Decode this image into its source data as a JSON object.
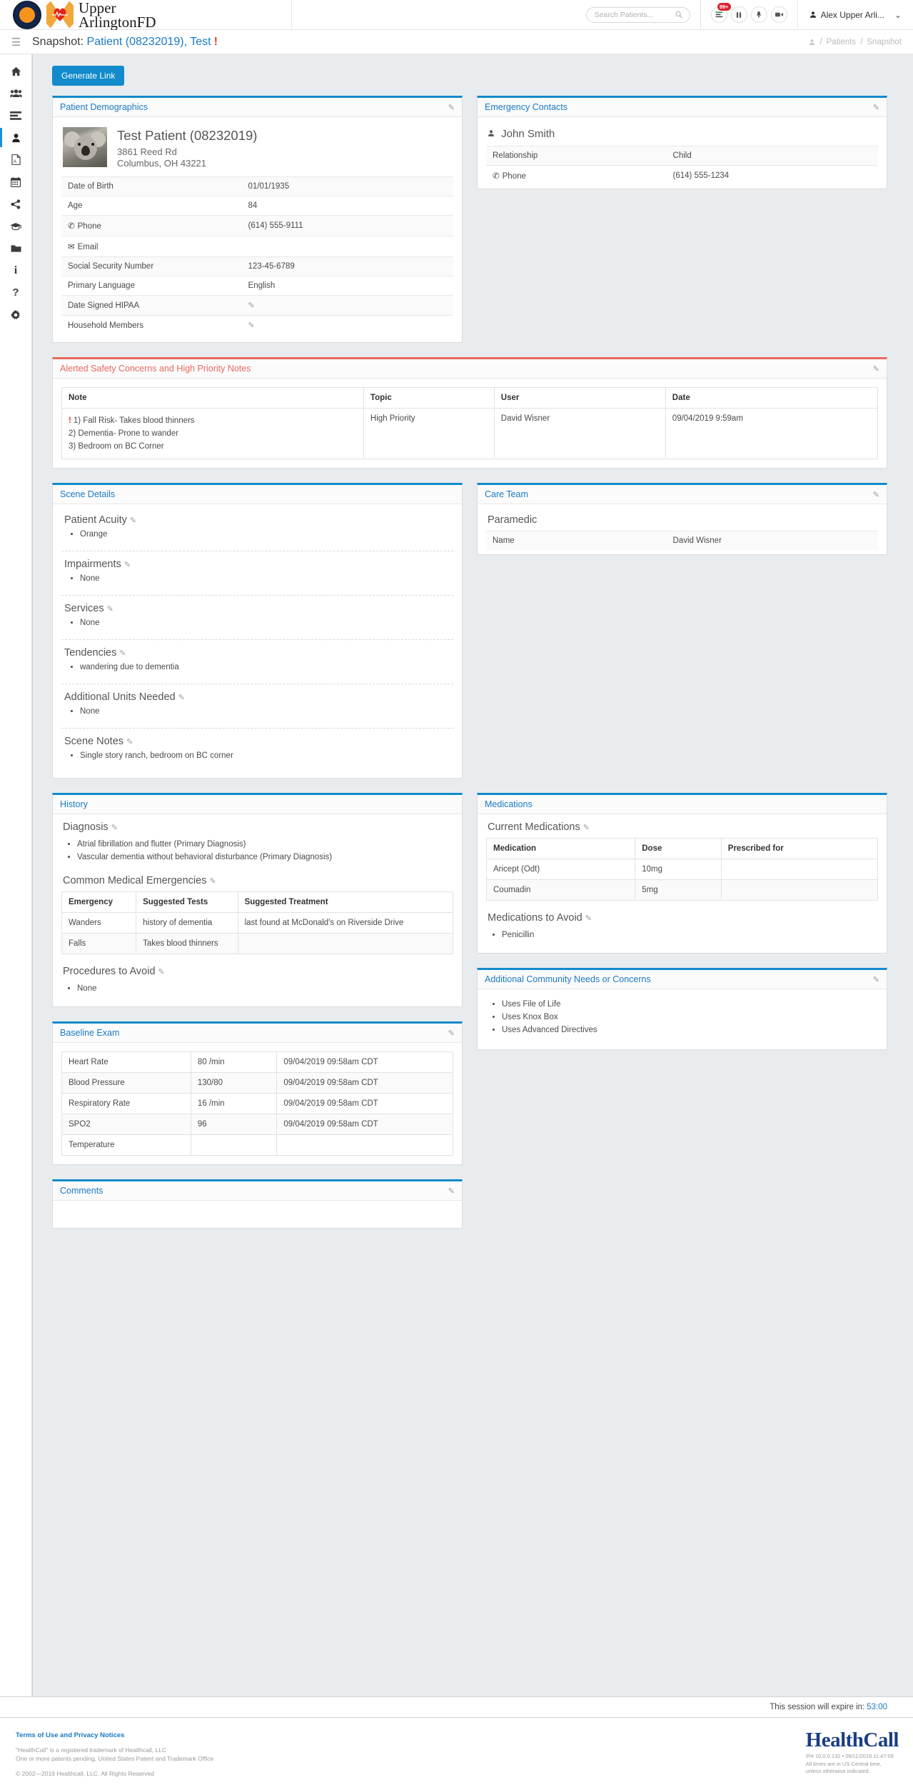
{
  "header": {
    "brand_line1": "Upper",
    "brand_line2": "ArlingtonFD",
    "search_placeholder": "Search Patients...",
    "notification_badge": "99+",
    "user_name": "Alex Upper Arli...",
    "icons": [
      "list-badge-icon",
      "pause-icon",
      "bell-icon",
      "video-icon"
    ]
  },
  "titlebar": {
    "prefix": "Snapshot:",
    "patient_link": "Patient (08232019), Test",
    "alert_mark": "!",
    "breadcrumb": [
      "Patients",
      "Snapshot"
    ]
  },
  "sidebar": {
    "items": [
      {
        "name": "home",
        "glyph": "⌂"
      },
      {
        "name": "users",
        "glyph": "👥"
      },
      {
        "name": "list",
        "glyph": "☰"
      },
      {
        "name": "patient",
        "glyph": "👤"
      },
      {
        "name": "pdf",
        "glyph": "🗎"
      },
      {
        "name": "calendar",
        "glyph": "📅"
      },
      {
        "name": "share",
        "glyph": "⛓"
      },
      {
        "name": "education",
        "glyph": "🎓"
      },
      {
        "name": "folder",
        "glyph": "📁"
      },
      {
        "name": "info",
        "glyph": "ℹ"
      },
      {
        "name": "help",
        "glyph": "?"
      },
      {
        "name": "settings",
        "glyph": "⚙"
      }
    ]
  },
  "actions": {
    "generate_link": "Generate Link"
  },
  "demographics": {
    "title": "Patient Demographics",
    "patient_name": "Test Patient (08232019)",
    "address_line1": "3861 Reed Rd",
    "address_line2": "Columbus, OH 43221",
    "rows": [
      {
        "label": "Date of Birth",
        "value": "01/01/1935",
        "icon": ""
      },
      {
        "label": "Age",
        "value": "84",
        "icon": ""
      },
      {
        "label": "Phone",
        "value": "(614) 555-9111",
        "icon": "phone-icon"
      },
      {
        "label": "Email",
        "value": "",
        "icon": "envelope-icon"
      },
      {
        "label": "Social Security Number",
        "value": "123-45-6789",
        "icon": ""
      },
      {
        "label": "Primary Language",
        "value": "English",
        "icon": ""
      },
      {
        "label": "Date Signed HIPAA",
        "value": "",
        "icon": "",
        "edit": true
      },
      {
        "label": "Household Members",
        "value": "",
        "icon": "",
        "edit": true
      }
    ]
  },
  "emergency_contacts": {
    "title": "Emergency Contacts",
    "contact_name": "John Smith",
    "rows": [
      {
        "label": "Relationship",
        "value": "Child",
        "icon": ""
      },
      {
        "label": "Phone",
        "value": "(614) 555-1234",
        "icon": "phone-icon"
      }
    ]
  },
  "safety": {
    "title": "Alerted Safety Concerns and High Priority Notes",
    "columns": [
      "Note",
      "Topic",
      "User",
      "Date"
    ],
    "rows": [
      {
        "note_lines": [
          "1) Fall Risk- Takes blood thinners",
          "2) Dementia- Prone to wander",
          "3) Bedroom on BC Corner"
        ],
        "topic": "High Priority",
        "user": "David Wisner",
        "date": "09/04/2019 9:59am"
      }
    ]
  },
  "scene_details": {
    "title": "Scene Details",
    "sections": [
      {
        "heading": "Patient Acuity",
        "items": [
          "Orange"
        ]
      },
      {
        "heading": "Impairments",
        "items": [
          "None"
        ]
      },
      {
        "heading": "Services",
        "items": [
          "None"
        ]
      },
      {
        "heading": "Tendencies",
        "items": [
          "wandering due to dementia"
        ]
      },
      {
        "heading": "Additional Units Needed",
        "items": [
          "None"
        ]
      },
      {
        "heading": "Scene Notes",
        "items": [
          "Single story ranch, bedroom on BC corner"
        ]
      }
    ]
  },
  "care_team": {
    "title": "Care Team",
    "role": "Paramedic",
    "rows": [
      {
        "label": "Name",
        "value": "David Wisner"
      }
    ]
  },
  "history": {
    "title": "History",
    "diagnosis_heading": "Diagnosis",
    "diagnosis": [
      "Atrial fibrillation and flutter (Primary Diagnosis)",
      "Vascular dementia without behavioral disturbance (Primary Diagnosis)"
    ],
    "emergencies_heading": "Common Medical Emergencies",
    "emergencies_columns": [
      "Emergency",
      "Suggested Tests",
      "Suggested Treatment"
    ],
    "emergencies_rows": [
      [
        "Wanders",
        "history of dementia",
        "last found at McDonald's on Riverside Drive"
      ],
      [
        "Falls",
        "Takes blood thinners",
        ""
      ]
    ],
    "procedures_heading": "Procedures to Avoid",
    "procedures": [
      "None"
    ]
  },
  "medications": {
    "title": "Medications",
    "current_heading": "Current Medications",
    "columns": [
      "Medication",
      "Dose",
      "Prescribed for"
    ],
    "rows": [
      [
        "Aricept (Odt)",
        "10mg",
        ""
      ],
      [
        "Coumadin",
        "5mg",
        ""
      ]
    ],
    "avoid_heading": "Medications to Avoid",
    "avoid": [
      "Penicillin"
    ]
  },
  "community": {
    "title": "Additional Community Needs or Concerns",
    "items": [
      "Uses File of Life",
      "Uses Knox Box",
      "Uses Advanced Directives"
    ]
  },
  "baseline": {
    "title": "Baseline Exam",
    "rows": [
      [
        "Heart Rate",
        "80 /min",
        "09/04/2019 09:58am CDT"
      ],
      [
        "Blood Pressure",
        "130/80",
        "09/04/2019 09:58am CDT"
      ],
      [
        "Respiratory Rate",
        "16 /min",
        "09/04/2019 09:58am CDT"
      ],
      [
        "SPO2",
        "96",
        "09/04/2019 09:58am CDT"
      ],
      [
        "Temperature",
        "",
        ""
      ]
    ]
  },
  "comments": {
    "title": "Comments"
  },
  "session": {
    "label": "This session will expire in:",
    "time": "53:00"
  },
  "footer": {
    "terms": "Terms of Use and Privacy Notices",
    "line1": "\"HealthCall\" is a registered trademark of Healthcall, LLC",
    "line2": "One or more patents pending, United States Patent and Trademark Office",
    "line3": "© 2002—2019 Healthcall, LLC. All Rights Reserved",
    "logo": "HealthCall",
    "ip": "IP# 10.0.0.132 • 09/11/2019 11:47:09",
    "tz1": "All times are in US Central time,",
    "tz2": "unless otherwise indicated."
  },
  "colors": {
    "accent": "#128acb",
    "link": "#1a79c4",
    "alert": "#e8695e",
    "danger": "#e23a30"
  }
}
